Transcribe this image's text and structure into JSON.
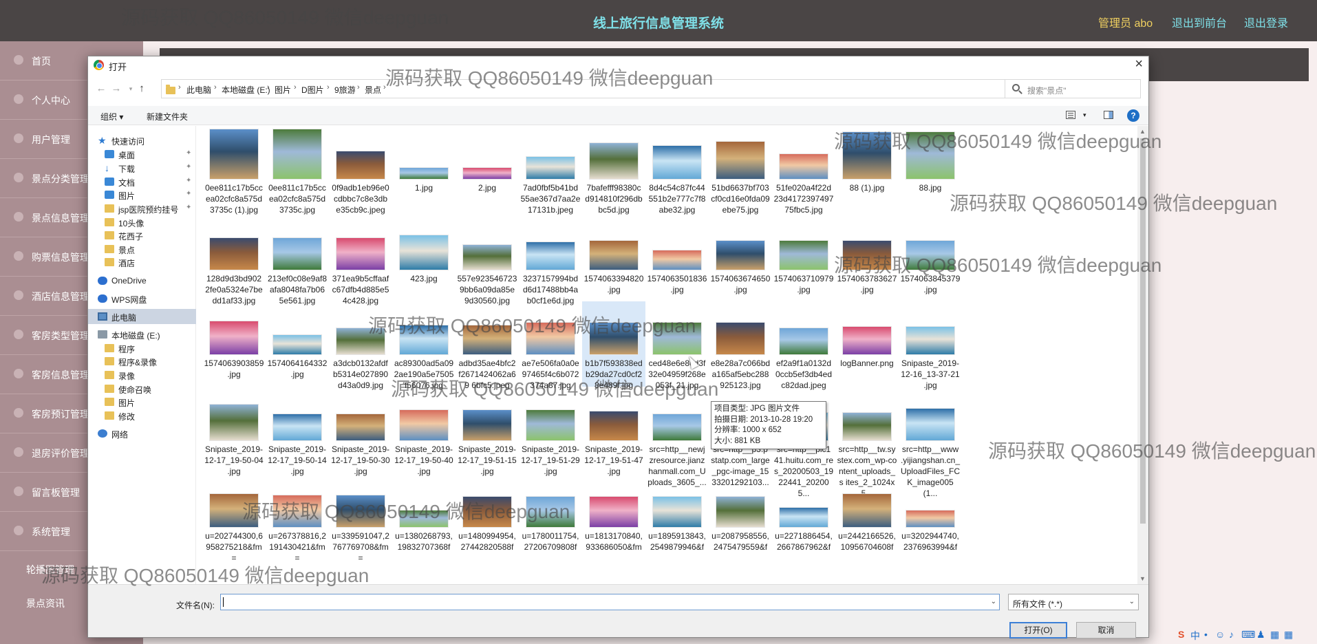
{
  "app": {
    "title": "线上旅行信息管理系统",
    "admin_label": "管理员 abo",
    "back_link": "退出到前台",
    "logout_link": "退出登录"
  },
  "sidebar": {
    "items": [
      "首页",
      "个人中心",
      "用户管理",
      "景点分类管理",
      "景点信息管理",
      "购票信息管理",
      "酒店信息管理",
      "客房类型管理",
      "客房信息管理",
      "客房预订管理",
      "退房评价管理",
      "留言板管理",
      "系统管理"
    ],
    "subitems": [
      "轮播图管理",
      "景点资讯"
    ]
  },
  "dialog": {
    "title": "打开",
    "breadcrumb": [
      "此电脑",
      "本地磁盘 (E:)",
      "图片",
      "D图片",
      "9旅游",
      "景点"
    ],
    "search_placeholder": "搜索\"景点\"",
    "organize": "组织",
    "new_folder": "新建文件夹",
    "nav_items": [
      {
        "label": "快速访问",
        "icon": "star-icon",
        "pinned": false
      },
      {
        "label": "桌面",
        "icon": "desktop-icon",
        "pinned": true
      },
      {
        "label": "下载",
        "icon": "download-icon",
        "pinned": true
      },
      {
        "label": "文档",
        "icon": "document-icon",
        "pinned": true
      },
      {
        "label": "图片",
        "icon": "pictures-icon",
        "pinned": true
      },
      {
        "label": "jsp医院预约挂号",
        "icon": "folder-icon",
        "pinned": true
      },
      {
        "label": "10头像",
        "icon": "folder-icon",
        "pinned": false
      },
      {
        "label": "花西子",
        "icon": "folder-icon",
        "pinned": false
      },
      {
        "label": "景点",
        "icon": "folder-icon",
        "pinned": false
      },
      {
        "label": "酒店",
        "icon": "folder-icon",
        "pinned": false
      },
      {
        "label": "OneDrive",
        "icon": "cloud-icon",
        "pinned": false
      },
      {
        "label": "WPS网盘",
        "icon": "cloud-icon",
        "pinned": false
      },
      {
        "label": "此电脑",
        "icon": "computer-icon",
        "pinned": false
      },
      {
        "label": "本地磁盘 (E:)",
        "icon": "drive-icon",
        "pinned": false
      },
      {
        "label": "程序",
        "icon": "folder-icon",
        "pinned": false
      },
      {
        "label": "程序&录像",
        "icon": "folder-icon",
        "pinned": false
      },
      {
        "label": "录像",
        "icon": "folder-icon",
        "pinned": false
      },
      {
        "label": "使命召唤",
        "icon": "folder-icon",
        "pinned": false
      },
      {
        "label": "图片",
        "icon": "folder-icon",
        "pinned": false
      },
      {
        "label": "修改",
        "icon": "folder-icon",
        "pinned": false
      },
      {
        "label": "网络",
        "icon": "network-icon",
        "pinned": false
      }
    ],
    "files": [
      "0ee811c17b5cc ea02cfc8a575d 3735c (1).jpg",
      "0ee811c17b5cc ea02cfc8a575d 3735c.jpg",
      "0f9adb1eb96e0 cdbbc7c8e3db e35cb9c.jpeg",
      "1.jpg",
      "2.jpg",
      "7ad0fbf5b41bd 55ae367d7aa2e 17131b.jpeg",
      "7bafefff98380c d914810f296db bc5d.jpg",
      "8d4c54c87fc44 551b2e777c7f8 abe32.jpg",
      "51bd6637bf703 cf0cd16e0fda09 ebe75.jpg",
      "51fe020a4f22d 23d4172397497 75fbc5.jpg",
      "88 (1).jpg",
      "88.jpg",
      "128d9d3bd902 2fe0a5324e7be dd1af33.jpg",
      "213ef0c08e9af8 afa8048fa7b06 5e561.jpg",
      "371ea9b5cffaaf c67dfb4d885e5 4c428.jpg",
      "423.jpg",
      "557e923546723 9bb6a09da85e 9d30560.jpg",
      "3237157994bd d6d17488bb4a b0cf1e6d.jpg",
      "1574063394820 .jpg",
      "1574063501836 .jpg",
      "1574063674650 .jpg",
      "1574063710979 .jpg",
      "1574063783627 .jpg",
      "1574063845379 .jpg",
      "1574063903859 .jpg",
      "1574064164332 .jpg",
      "a3dcb0132afdf b5314e027890 d43a0d9.jpg",
      "ac89300ad5a09 2ae190a5e7505 f56076.jpg",
      "adbd35ae4bfc2 f2671424062a69 6bfc5.jpeg",
      "ae7e506fa0a0e 97465f4c6b072 374a87.jpg",
      "b1b7f593838ed b29da27cd0cf2 8e489f.jpg",
      "ced48e6e86d3f 32e04959f268e 053f_21.jpg",
      "e8e28a7c066bd a165af5ebc288 925123.jpg",
      "ef2a9f1a0132d 0ccb5ef3db4ed c82dad.jpeg",
      "logBanner.png",
      "Snipaste_2019- 12-16_13-37-21 .jpg",
      "Snipaste_2019- 12-17_19-50-04 .jpg",
      "Snipaste_2019- 12-17_19-50-14 .jpg",
      "Snipaste_2019- 12-17_19-50-30 .jpg",
      "Snipaste_2019- 12-17_19-50-40 .jpg",
      "Snipaste_2019- 12-17_19-51-15 .jpg",
      "Snipaste_2019- 12-17_19-51-29 .jpg",
      "Snipaste_2019- 12-17_19-51-47 .jpg",
      "src=http__newj zresource.jianz hanmall.com_U ploads_3605_...",
      "src=http__p3.p statp.com_large _pgc-image_15 33201292103...",
      "src=http__pic1 41.huitu.com_re s_20200503_19 22441_202005...",
      "src=http__tw.sy stex.com_wp-co ntent_uploads_s ites_2_1024x5...",
      "src=http__www .yijiangshan.cn_ UploadFiles_FC K_image005(1...",
      "u=202744300,6 958275218&fm=",
      "u=267378816,2 191430421&fm=",
      "u=339591047,2 767769708&fm=",
      "u=1380268793, 19832707368f",
      "u=1480994954, 27442820588f",
      "u=1780011754, 27206709808f",
      "u=1813170840, 933686050&fm",
      "u=1895913843, 2549879946&f",
      "u=2087958556, 2475479559&f",
      "u=2271886454, 2667867962&f",
      "u=2442166526, 10956704608f",
      "u=3202944740, 2376963994&f"
    ],
    "tooltip": {
      "type": "项目类型: JPG 图片文件",
      "date": "拍摄日期: 2013-10-28 19:20",
      "resolution": "分辨率: 1000 x 652",
      "size": "大小: 881 KB"
    },
    "filename_label": "文件名(N):",
    "filename_value": "",
    "filter_value": "所有文件 (*.*)",
    "open_button": "打开(O)",
    "cancel_button": "取消"
  },
  "watermark_text": "源码获取 QQ86050149 微信deepguan",
  "colors": {
    "topbar": "#4a4545",
    "sidebar": "#aa8e92",
    "title_accent": "#7fe0e8",
    "admin_accent": "#f0d060",
    "selection": "#ccd5e2"
  }
}
